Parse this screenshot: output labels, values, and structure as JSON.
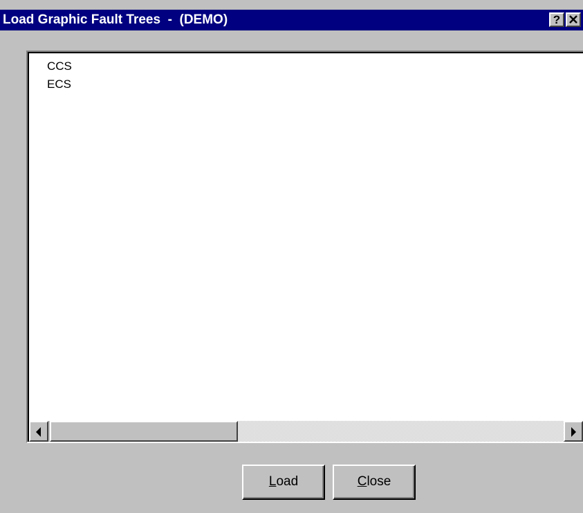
{
  "window": {
    "title": "Load Graphic Fault Trees  -  (DEMO)",
    "help_glyph": "?",
    "close_icon": "close-icon"
  },
  "list": {
    "items": [
      "CCS",
      "ECS"
    ]
  },
  "scrollbar": {
    "left_icon": "arrow-left-icon",
    "right_icon": "arrow-right-icon"
  },
  "buttons": {
    "load": {
      "mnemonic": "L",
      "rest": "oad"
    },
    "close": {
      "mnemonic": "C",
      "rest": "lose"
    }
  },
  "colors": {
    "titlebar": "#000080",
    "face": "#c0c0c0",
    "list_bg": "#ffffff"
  }
}
